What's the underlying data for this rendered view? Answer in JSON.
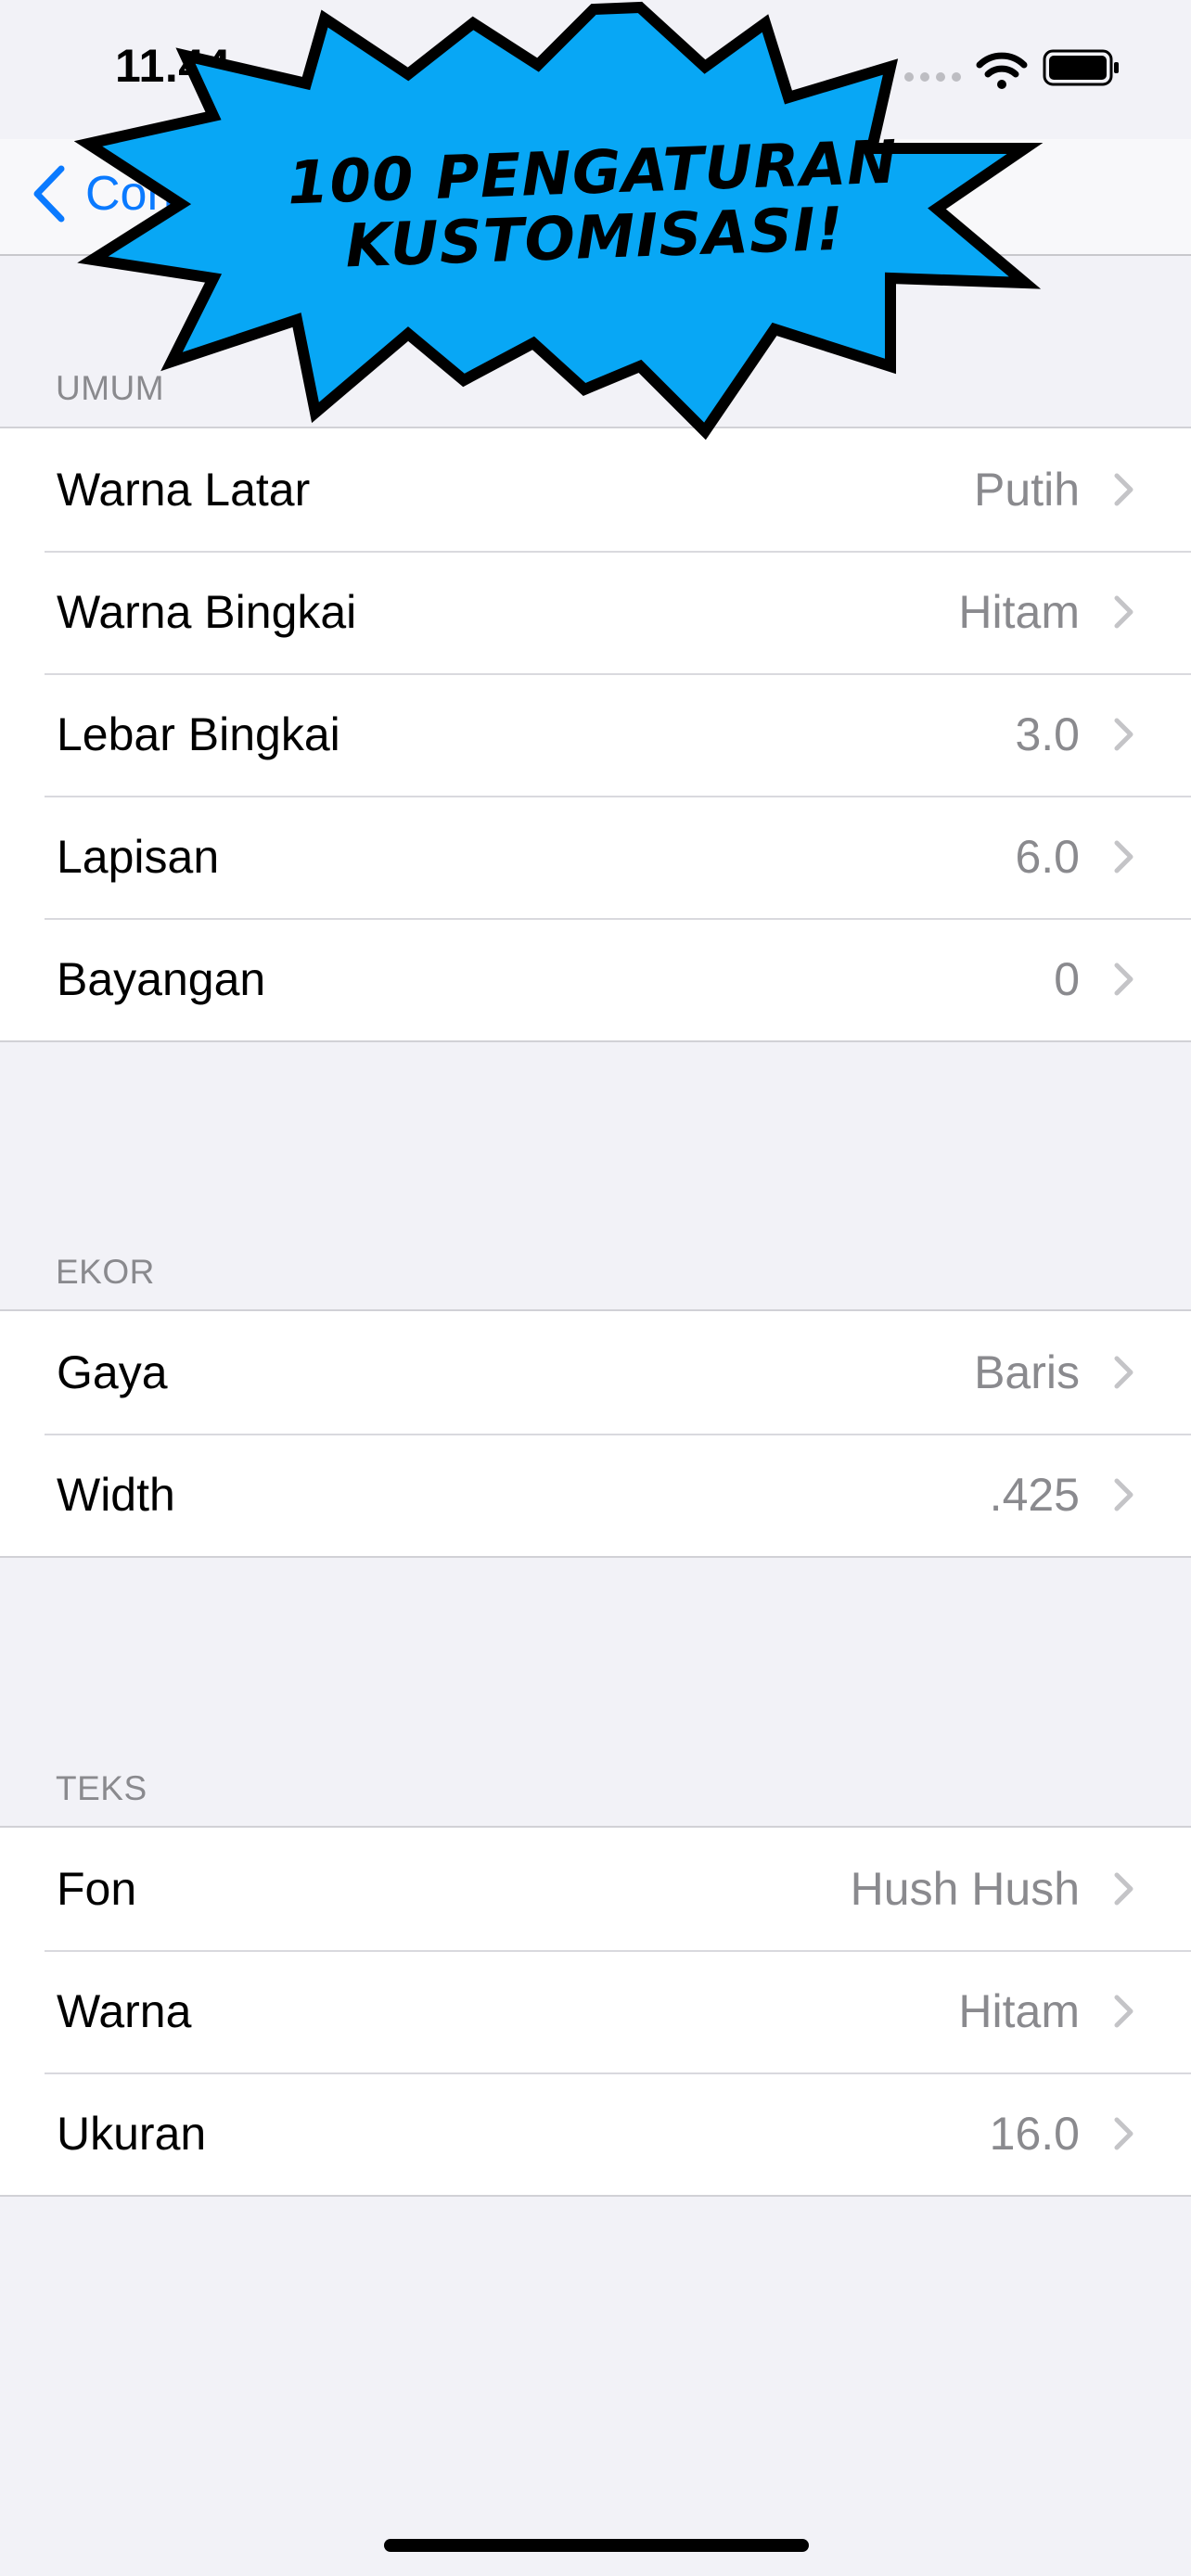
{
  "status_bar": {
    "time": "11.44"
  },
  "nav": {
    "back_label": "Con"
  },
  "promo": {
    "line1": "100 PENGATURAN",
    "line2": "KUSTOMISASI!"
  },
  "sections": {
    "general": {
      "header": "UMUM",
      "rows": [
        {
          "label": "Warna Latar",
          "value": "Putih"
        },
        {
          "label": "Warna Bingkai",
          "value": "Hitam"
        },
        {
          "label": "Lebar Bingkai",
          "value": "3.0"
        },
        {
          "label": "Lapisan",
          "value": "6.0"
        },
        {
          "label": "Bayangan",
          "value": "0"
        }
      ]
    },
    "tail": {
      "header": "EKOR",
      "rows": [
        {
          "label": "Gaya",
          "value": "Baris"
        },
        {
          "label": "Width",
          "value": ".425"
        }
      ]
    },
    "text": {
      "header": "TEKS",
      "rows": [
        {
          "label": "Fon",
          "value": "Hush Hush"
        },
        {
          "label": "Warna",
          "value": "Hitam"
        },
        {
          "label": "Ukuran",
          "value": "16.0"
        }
      ]
    }
  },
  "colors": {
    "accent": "#0A7AFF",
    "promo_fill": "#08A7F5",
    "background": "#F2F2F7"
  }
}
